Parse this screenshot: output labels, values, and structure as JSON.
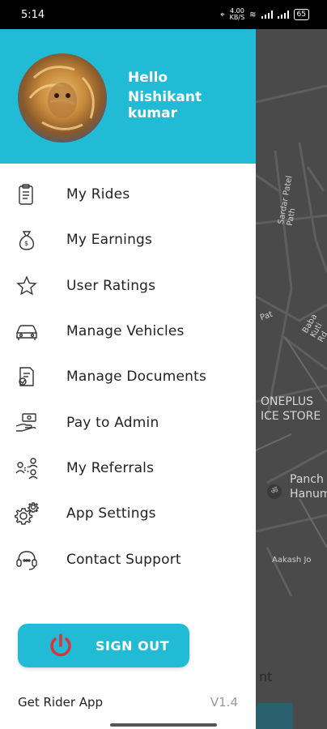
{
  "status_bar": {
    "time": "5:14",
    "data_speed": "4.00\nKB/S",
    "battery": "65"
  },
  "map": {
    "labels": [
      "Sardar Patel Path",
      "Baba Kuti Rd",
      "Pat",
      "ONEPLUS",
      "ICE STORE",
      "Panch",
      "Hanum",
      "Aakash Jo"
    ],
    "bottom_text": "nt"
  },
  "drawer": {
    "greeting": "Hello",
    "user_name": "Nishikant kumar",
    "menu": [
      {
        "label": "My Rides",
        "icon": "clipboard-list-icon"
      },
      {
        "label": "My Earnings",
        "icon": "money-bag-icon"
      },
      {
        "label": "User Ratings",
        "icon": "star-icon"
      },
      {
        "label": "Manage Vehicles",
        "icon": "car-icon"
      },
      {
        "label": "Manage Documents",
        "icon": "document-edit-icon"
      },
      {
        "label": "Pay to Admin",
        "icon": "hand-payment-icon"
      },
      {
        "label": "My Referrals",
        "icon": "referral-network-icon"
      },
      {
        "label": "App Settings",
        "icon": "gear-icon"
      },
      {
        "label": "Contact Support",
        "icon": "headset-icon"
      }
    ],
    "sign_out_label": "SIGN OUT",
    "footer_app_label": "Get Rider App",
    "version": "V1.4"
  },
  "colors": {
    "accent": "#21bbd6",
    "power_icon": "#e0323a"
  }
}
